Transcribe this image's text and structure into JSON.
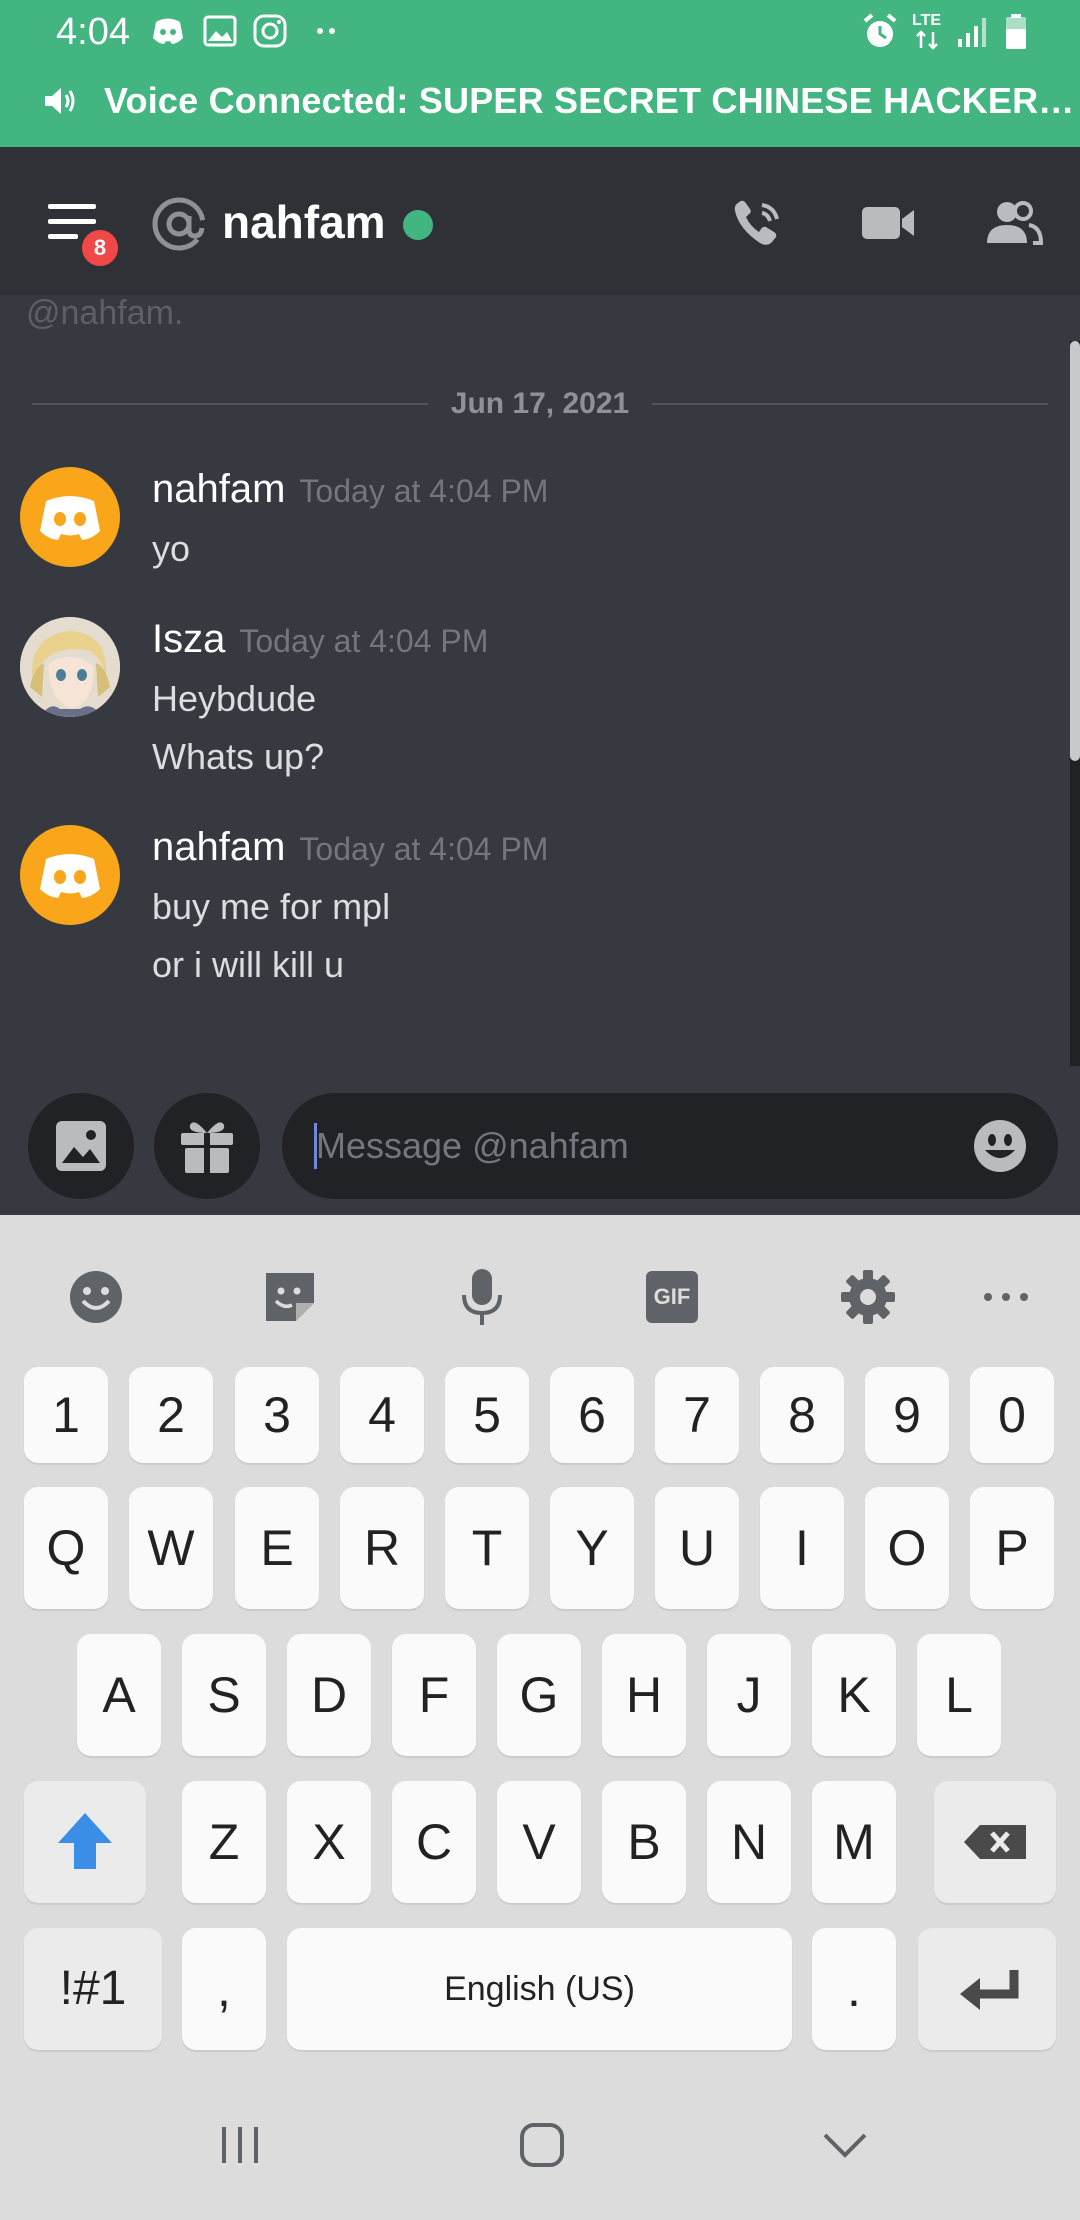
{
  "status_bar": {
    "time": "4:04",
    "notification_icons": [
      "discord-icon",
      "gallery-icon",
      "instagram-icon",
      "more-notifications-icon"
    ],
    "network_label": "LTE",
    "system_icons": [
      "alarm-icon",
      "lte-icon",
      "signal-icon",
      "battery-icon"
    ]
  },
  "voice_bar": {
    "text": "Voice Connected: SUPER SECRET CHINESE HACKER…",
    "color": "#43b581"
  },
  "header": {
    "menu_badge": "8",
    "username": "nahfam",
    "online": true,
    "actions": [
      "voice-call-icon",
      "video-call-icon",
      "members-icon"
    ]
  },
  "chat": {
    "intro_tail": "@nahfam.",
    "date_divider": "Jun 17, 2021",
    "messages": [
      {
        "author": "nahfam",
        "timestamp": "Today at 4:04 PM",
        "avatar": "discord-default-avatar",
        "lines": [
          "yo"
        ]
      },
      {
        "author": "Isza",
        "timestamp": "Today at 4:04 PM",
        "avatar": "anime-avatar",
        "lines": [
          "Heybdude",
          "Whats up?"
        ]
      },
      {
        "author": "nahfam",
        "timestamp": "Today at 4:04 PM",
        "avatar": "discord-default-avatar",
        "lines": [
          "buy me for mpl",
          "or i will kill u"
        ]
      }
    ]
  },
  "composer": {
    "placeholder": "Message @nahfam"
  },
  "keyboard": {
    "toolbar": [
      "emoji-icon",
      "sticker-icon",
      "microphone-icon",
      "gif-icon",
      "settings-icon",
      "more-icon"
    ],
    "gif_label": "GIF",
    "numbers": [
      "1",
      "2",
      "3",
      "4",
      "5",
      "6",
      "7",
      "8",
      "9",
      "0"
    ],
    "row1": [
      "Q",
      "W",
      "E",
      "R",
      "T",
      "Y",
      "U",
      "I",
      "O",
      "P"
    ],
    "row2": [
      "A",
      "S",
      "D",
      "F",
      "G",
      "H",
      "J",
      "K",
      "L"
    ],
    "row3": [
      "Z",
      "X",
      "C",
      "V",
      "B",
      "N",
      "M"
    ],
    "symbols_key": "!#1",
    "comma_key": ",",
    "space_key": "English (US)",
    "period_key": "."
  },
  "nav_bar": {
    "buttons": [
      "recent-apps-icon",
      "home-icon",
      "back-icon"
    ]
  }
}
